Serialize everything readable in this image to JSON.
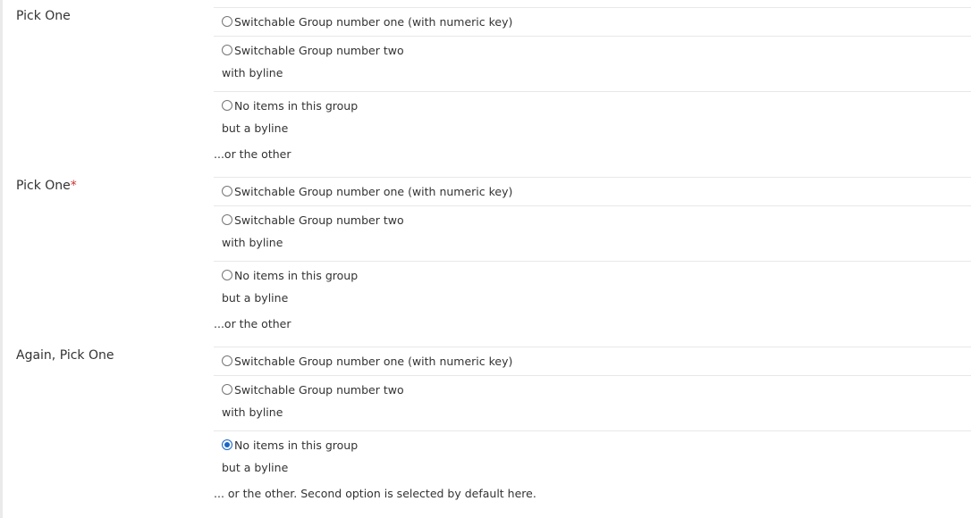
{
  "groups": [
    {
      "label": "Pick One",
      "required": false,
      "options": [
        {
          "text": "Switchable Group number one (with numeric key)",
          "byline": "",
          "checked": false
        },
        {
          "text": "Switchable Group number two",
          "byline": "with byline",
          "checked": false
        },
        {
          "text": "No items in this group",
          "byline": "but a byline",
          "checked": false
        }
      ],
      "hint": "...or the other"
    },
    {
      "label": "Pick One",
      "required": true,
      "required_mark": "*",
      "options": [
        {
          "text": "Switchable Group number one (with numeric key)",
          "byline": "",
          "checked": false
        },
        {
          "text": "Switchable Group number two",
          "byline": "with byline",
          "checked": false
        },
        {
          "text": "No items in this group",
          "byline": "but a byline",
          "checked": false
        }
      ],
      "hint": "...or the other"
    },
    {
      "label": "Again, Pick One",
      "required": false,
      "options": [
        {
          "text": "Switchable Group number one (with numeric key)",
          "byline": "",
          "checked": false
        },
        {
          "text": "Switchable Group number two",
          "byline": "with byline",
          "checked": false
        },
        {
          "text": "No items in this group",
          "byline": "but a byline",
          "checked": true
        }
      ],
      "hint": "... or the other. Second option is selected by default here."
    }
  ],
  "colors": {
    "accent": "#1a66c6",
    "required": "#cc3333",
    "divider": "#e8e8e8"
  }
}
